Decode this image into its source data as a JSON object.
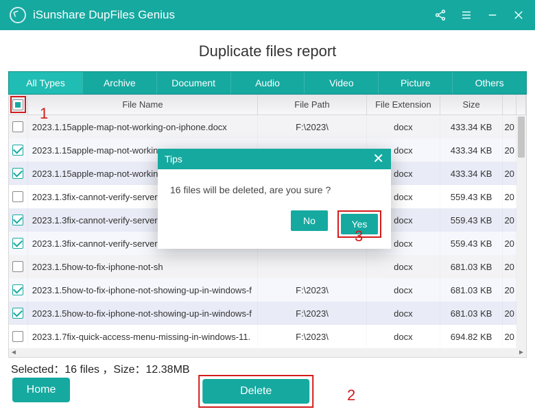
{
  "window": {
    "title": "iSunshare DupFiles Genius"
  },
  "heading": "Duplicate files report",
  "tabs": [
    "All Types",
    "Archive",
    "Document",
    "Audio",
    "Video",
    "Picture",
    "Others"
  ],
  "active_tab": 0,
  "columns": {
    "name": "File Name",
    "path": "File Path",
    "ext": "File Extension",
    "size": "Size"
  },
  "master_checkbox": "indeterminate",
  "rows": [
    {
      "checked": false,
      "name": "2023.1.15apple-map-not-working-on-iphone.docx",
      "path": "F:\\2023\\",
      "ext": "docx",
      "size": "433.34 KB",
      "tail": "20"
    },
    {
      "checked": true,
      "name": "2023.1.15apple-map-not-working",
      "path": "",
      "ext": "docx",
      "size": "433.34 KB",
      "tail": "20"
    },
    {
      "checked": true,
      "name": "2023.1.15apple-map-not-working",
      "path": "",
      "ext": "docx",
      "size": "433.34 KB",
      "tail": "20"
    },
    {
      "checked": false,
      "name": "2023.1.3fix-cannot-verify-server-",
      "path": "",
      "ext": "docx",
      "size": "559.43 KB",
      "tail": "20"
    },
    {
      "checked": true,
      "name": "2023.1.3fix-cannot-verify-server-",
      "path": "",
      "ext": "docx",
      "size": "559.43 KB",
      "tail": "20"
    },
    {
      "checked": true,
      "name": "2023.1.3fix-cannot-verify-server-",
      "path": "",
      "ext": "docx",
      "size": "559.43 KB",
      "tail": "20"
    },
    {
      "checked": false,
      "name": "2023.1.5how-to-fix-iphone-not-sh",
      "path": "",
      "ext": "docx",
      "size": "681.03 KB",
      "tail": "20"
    },
    {
      "checked": true,
      "name": "2023.1.5how-to-fix-iphone-not-showing-up-in-windows-f",
      "path": "F:\\2023\\",
      "ext": "docx",
      "size": "681.03 KB",
      "tail": "20"
    },
    {
      "checked": true,
      "name": "2023.1.5how-to-fix-iphone-not-showing-up-in-windows-f",
      "path": "F:\\2023\\",
      "ext": "docx",
      "size": "681.03 KB",
      "tail": "20"
    },
    {
      "checked": false,
      "name": "2023.1.7fix-quick-access-menu-missing-in-windows-11.",
      "path": "F:\\2023\\",
      "ext": "docx",
      "size": "694.82 KB",
      "tail": "20"
    }
  ],
  "status": "Selected：16  files ，Size：12.38MB",
  "buttons": {
    "home": "Home",
    "delete": "Delete"
  },
  "dialog": {
    "title": "Tips",
    "message": "16 files will be deleted, are you sure ?",
    "no": "No",
    "yes": "Yes"
  },
  "annotations": {
    "a1": "1",
    "a2": "2",
    "a3": "3"
  }
}
